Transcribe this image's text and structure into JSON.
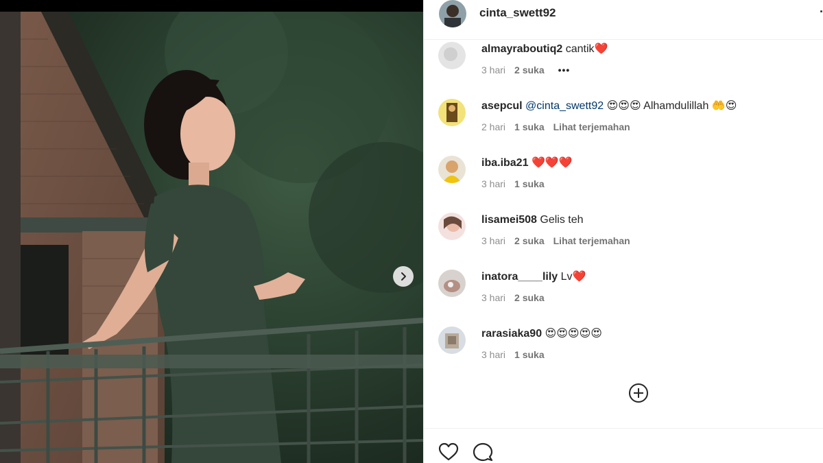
{
  "post": {
    "username": "cinta_swett92",
    "more_label": "."
  },
  "comments": [
    {
      "username": "almayraboutiq2",
      "mention": "",
      "text": "cantik❤️",
      "time": "3 hari",
      "likes": "2 suka",
      "translate": "",
      "more": "•••"
    },
    {
      "username": "asepcul",
      "mention": "@cinta_swett92",
      "text": "😍😍😍 Alhamdulillah 🤲😍",
      "time": "2 hari",
      "likes": "1 suka",
      "translate": "Lihat terjemahan",
      "more": ""
    },
    {
      "username": "iba.iba21",
      "mention": "",
      "text": "❤️❤️❤️",
      "time": "3 hari",
      "likes": "1 suka",
      "translate": "",
      "more": ""
    },
    {
      "username": "lisamei508",
      "mention": "",
      "text": "Gelis teh",
      "time": "3 hari",
      "likes": "2 suka",
      "translate": "Lihat terjemahan",
      "more": ""
    },
    {
      "username": "inatora____lily",
      "mention": "",
      "text": "Lv❤️",
      "time": "3 hari",
      "likes": "2 suka",
      "translate": "",
      "more": ""
    },
    {
      "username": "rarasiaka90",
      "mention": "",
      "text": "😍😍😍😍😍",
      "time": "3 hari",
      "likes": "1 suka",
      "translate": "",
      "more": ""
    }
  ],
  "icons": {
    "next": "chevron-right-icon",
    "load_more": "plus-circle-icon",
    "like": "heart-icon",
    "comment": "comment-icon"
  },
  "colors": {
    "mention": "#00376b",
    "meta": "#8e8e8e",
    "text": "#262626"
  }
}
